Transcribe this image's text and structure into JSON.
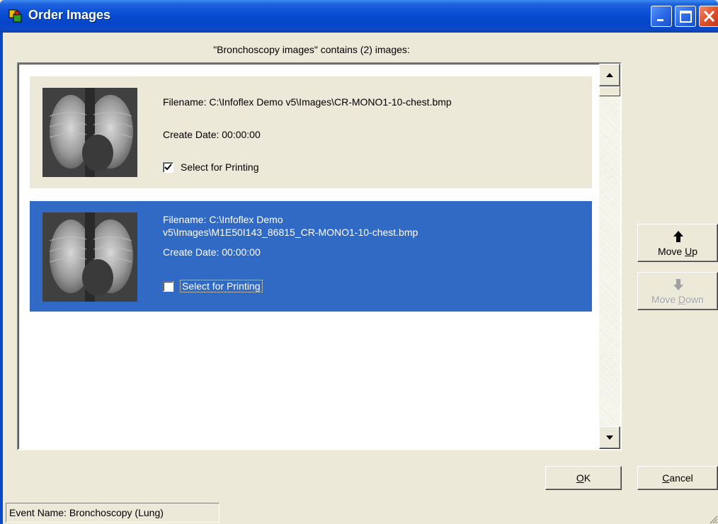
{
  "window": {
    "title": "Order Images",
    "icon": "app-icon",
    "controls": [
      "minimize-icon",
      "maximize-icon",
      "close-icon"
    ]
  },
  "header": {
    "text": "\"Bronchoscopy images\" contains (2) images:"
  },
  "images": [
    {
      "filename": "Filename: C:\\Infoflex Demo v5\\Images\\CR-MONO1-10-chest.bmp",
      "create_date": "Create Date: 00:00:00",
      "select_label": "Select for Printing",
      "selected_for_printing": true,
      "highlighted": false,
      "thumbnail": "chest-xray-thumbnail"
    },
    {
      "filename_line1": "Filename: C:\\Infoflex Demo",
      "filename_line2": "v5\\Images\\M1E50I143_86815_CR-MONO1-10-chest.bmp",
      "create_date": "Create Date: 00:00:00",
      "select_label": "Select for Printing",
      "selected_for_printing": false,
      "highlighted": true,
      "thumbnail": "chest-xray-thumbnail"
    }
  ],
  "buttons": {
    "move_up": {
      "pre": "Move ",
      "accel": "U",
      "post": "p",
      "icon": "arrow-up-icon",
      "enabled": true
    },
    "move_down": {
      "pre": "Move ",
      "accel": "D",
      "post": "own",
      "icon": "arrow-down-icon",
      "enabled": false
    },
    "ok": {
      "pre": "",
      "accel": "O",
      "post": "K"
    },
    "cancel": {
      "pre": "",
      "accel": "C",
      "post": "ancel"
    }
  },
  "statusbar": {
    "event_name": "Event Name: Bronchoscopy (Lung)"
  },
  "colors": {
    "selection": "#316ac5",
    "title_bar": "#0a4fd6",
    "dialog_bg": "#ece9d8"
  }
}
